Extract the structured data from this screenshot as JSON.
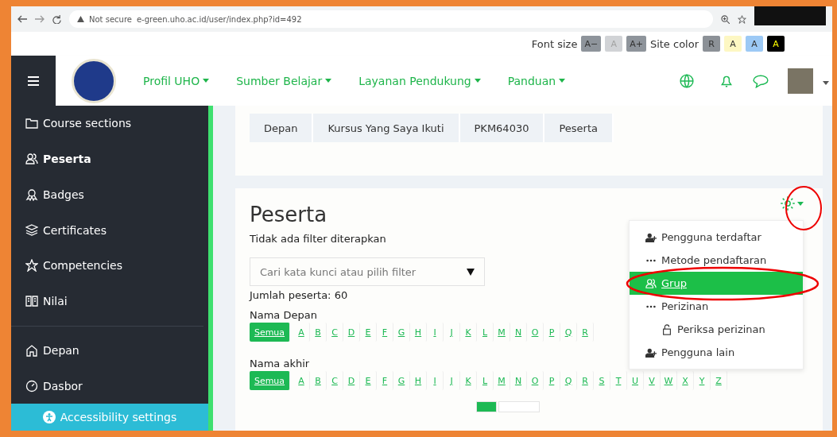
{
  "browser": {
    "security": "Not secure",
    "url": "e-green.uho.ac.id/user/index.php?id=492"
  },
  "accessibility_bar": {
    "font_label": "Font size",
    "font_buttons": [
      {
        "label": "A−",
        "disabled": false
      },
      {
        "label": "A",
        "disabled": true
      },
      {
        "label": "A+",
        "disabled": false
      }
    ],
    "color_label": "Site color",
    "color_buttons": [
      {
        "label": "R",
        "color": "#8c9197"
      },
      {
        "label": "A",
        "color": "#fdf7c3"
      },
      {
        "label": "A",
        "color": "#9cc9f5"
      },
      {
        "label": "A",
        "color": "#000000"
      }
    ]
  },
  "navbar": {
    "menus": [
      "Profil UHO",
      "Sumber Belajar",
      "Layanan Pendukung",
      "Panduan"
    ]
  },
  "sidebar": {
    "items": [
      {
        "label": "Course sections",
        "kind": "folder",
        "selected": false
      },
      {
        "label": "Peserta",
        "kind": "users",
        "selected": true
      },
      {
        "label": "Badges",
        "kind": "badge",
        "selected": false
      },
      {
        "label": "Certificates",
        "kind": "layers",
        "selected": false
      },
      {
        "label": "Competencies",
        "kind": "star",
        "selected": false
      },
      {
        "label": "Nilai",
        "kind": "book",
        "selected": false
      }
    ],
    "bottom_items": [
      {
        "label": "Depan",
        "kind": "home",
        "selected": false
      },
      {
        "label": "Dasbor",
        "kind": "gauge",
        "selected": false
      }
    ],
    "footer": "Accessibility settings"
  },
  "breadcrumb": [
    "Depan",
    "Kursus Yang Saya Ikuti",
    "PKM64030",
    "Peserta"
  ],
  "page": {
    "title": "Peserta",
    "filter_status": "Tidak ada filter diterapkan",
    "search": {
      "placeholder": "Cari kata kunci atau pilih filter"
    },
    "count": "Jumlah peserta: 60",
    "initials": [
      {
        "label": "Nama Depan",
        "letters": [
          {
            "label": "Semua",
            "selected": true
          },
          {
            "label": "A",
            "selected": false
          },
          {
            "label": "B",
            "selected": false
          },
          {
            "label": "C",
            "selected": false
          },
          {
            "label": "D",
            "selected": false
          },
          {
            "label": "E",
            "selected": false
          },
          {
            "label": "F",
            "selected": false
          },
          {
            "label": "G",
            "selected": false
          },
          {
            "label": "H",
            "selected": false
          },
          {
            "label": "I",
            "selected": false
          },
          {
            "label": "J",
            "selected": false
          },
          {
            "label": "K",
            "selected": false
          },
          {
            "label": "L",
            "selected": false
          },
          {
            "label": "M",
            "selected": false
          },
          {
            "label": "N",
            "selected": false
          },
          {
            "label": "O",
            "selected": false
          },
          {
            "label": "P",
            "selected": false
          },
          {
            "label": "Q",
            "selected": false
          },
          {
            "label": "R",
            "selected": false
          }
        ]
      },
      {
        "label": "Nama akhir",
        "letters": [
          {
            "label": "Semua",
            "selected": true
          },
          {
            "label": "A",
            "selected": false
          },
          {
            "label": "B",
            "selected": false
          },
          {
            "label": "C",
            "selected": false
          },
          {
            "label": "D",
            "selected": false
          },
          {
            "label": "E",
            "selected": false
          },
          {
            "label": "F",
            "selected": false
          },
          {
            "label": "G",
            "selected": false
          },
          {
            "label": "H",
            "selected": false
          },
          {
            "label": "I",
            "selected": false
          },
          {
            "label": "J",
            "selected": false
          },
          {
            "label": "K",
            "selected": false
          },
          {
            "label": "L",
            "selected": false
          },
          {
            "label": "M",
            "selected": false
          },
          {
            "label": "N",
            "selected": false
          },
          {
            "label": "O",
            "selected": false
          },
          {
            "label": "P",
            "selected": false
          },
          {
            "label": "Q",
            "selected": false
          },
          {
            "label": "R",
            "selected": false
          },
          {
            "label": "S",
            "selected": false
          },
          {
            "label": "T",
            "selected": false
          },
          {
            "label": "U",
            "selected": false
          },
          {
            "label": "V",
            "selected": false
          },
          {
            "label": "W",
            "selected": false
          },
          {
            "label": "X",
            "selected": false
          },
          {
            "label": "Y",
            "selected": false
          },
          {
            "label": "Z",
            "selected": false
          }
        ]
      }
    ]
  },
  "settings_menu": {
    "items": [
      {
        "label": "Pengguna terdaftar",
        "kind": "user-plus",
        "selected": false
      },
      {
        "label": "Metode pendaftaran",
        "kind": "dots",
        "selected": false
      },
      {
        "label": "Grup",
        "kind": "users",
        "selected": true
      },
      {
        "label": "Perizinan",
        "kind": "dots",
        "selected": false,
        "children": [
          {
            "label": "Periksa perizinan",
            "kind": "lock",
            "selected": false
          }
        ]
      },
      {
        "label": "Pengguna lain",
        "kind": "user-plus",
        "selected": false
      }
    ]
  }
}
